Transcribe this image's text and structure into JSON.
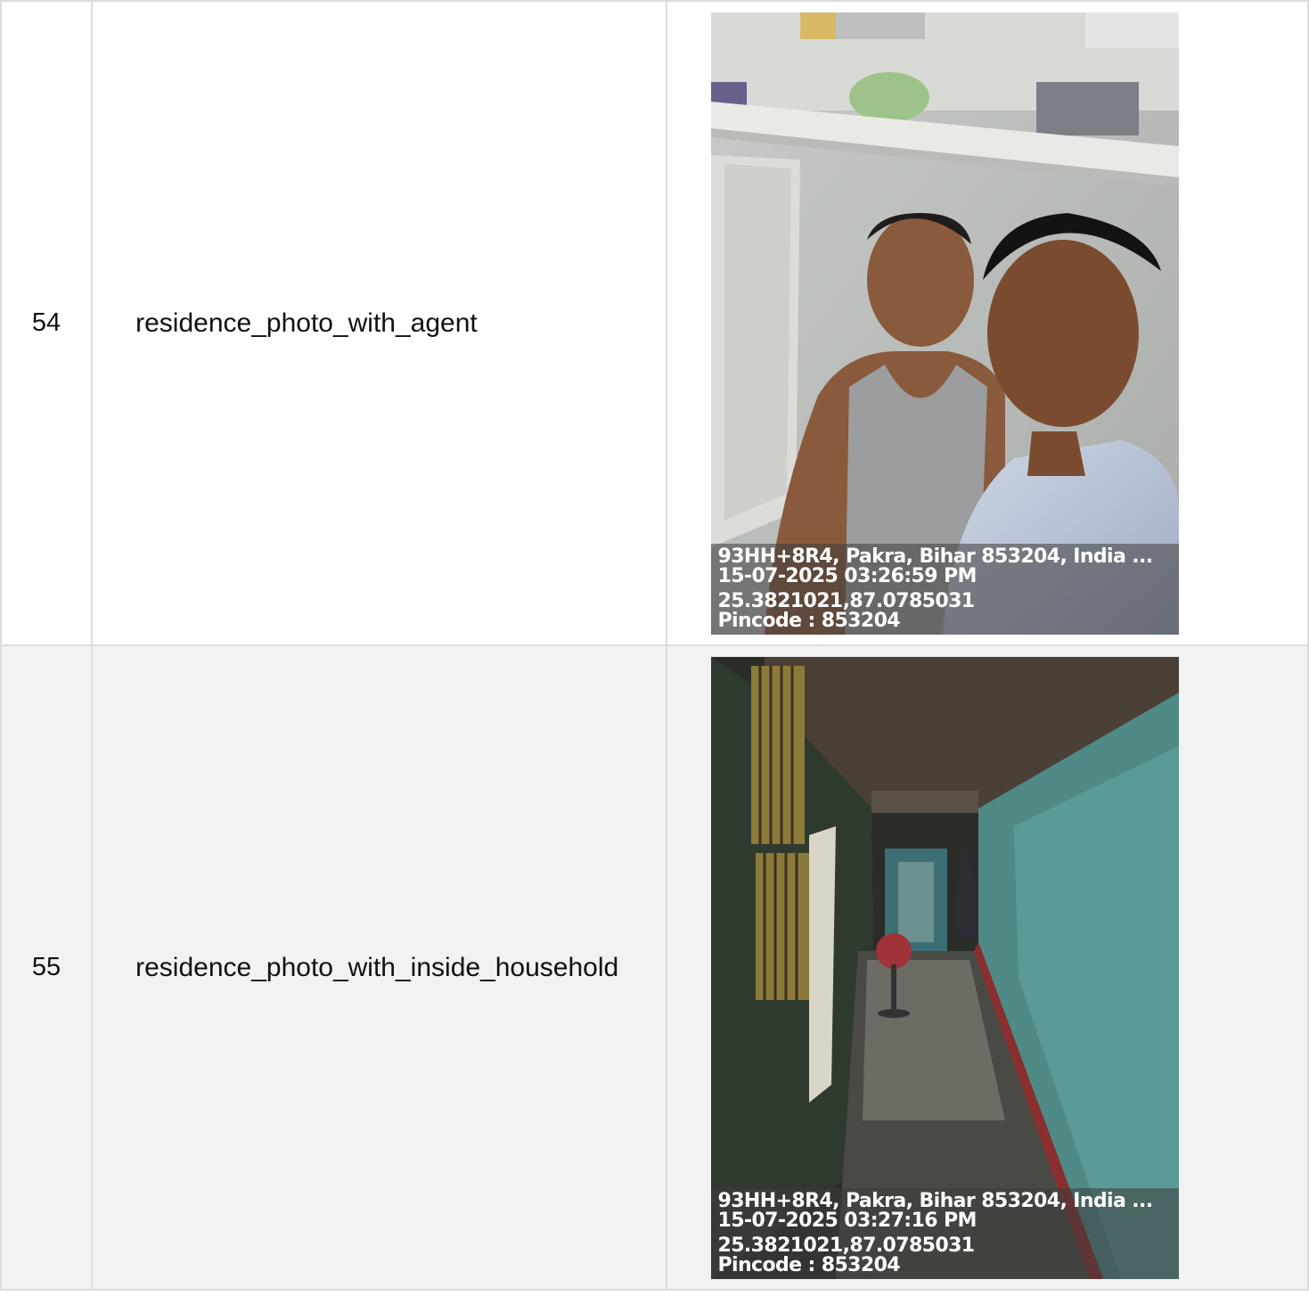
{
  "rows": [
    {
      "number": "54",
      "name": "residence_photo_with_agent",
      "photo": {
        "subject": "two men selfie indoors",
        "overlay": {
          "address": "93HH+8R4, Pakra, Bihar 853204, India ...",
          "datetime": "15-07-2025 03:26:59 PM",
          "coordinates": "25.3821021,87.0785031",
          "pincode": "Pincode : 853204"
        }
      }
    },
    {
      "number": "55",
      "name": "residence_photo_with_inside_household",
      "photo": {
        "subject": "narrow corridor inside house",
        "overlay": {
          "address": "93HH+8R4, Pakra, Bihar 853204, India ...",
          "datetime": "15-07-2025 03:27:16 PM",
          "coordinates": "25.3821021,87.0785031",
          "pincode": "Pincode : 853204"
        }
      }
    }
  ]
}
